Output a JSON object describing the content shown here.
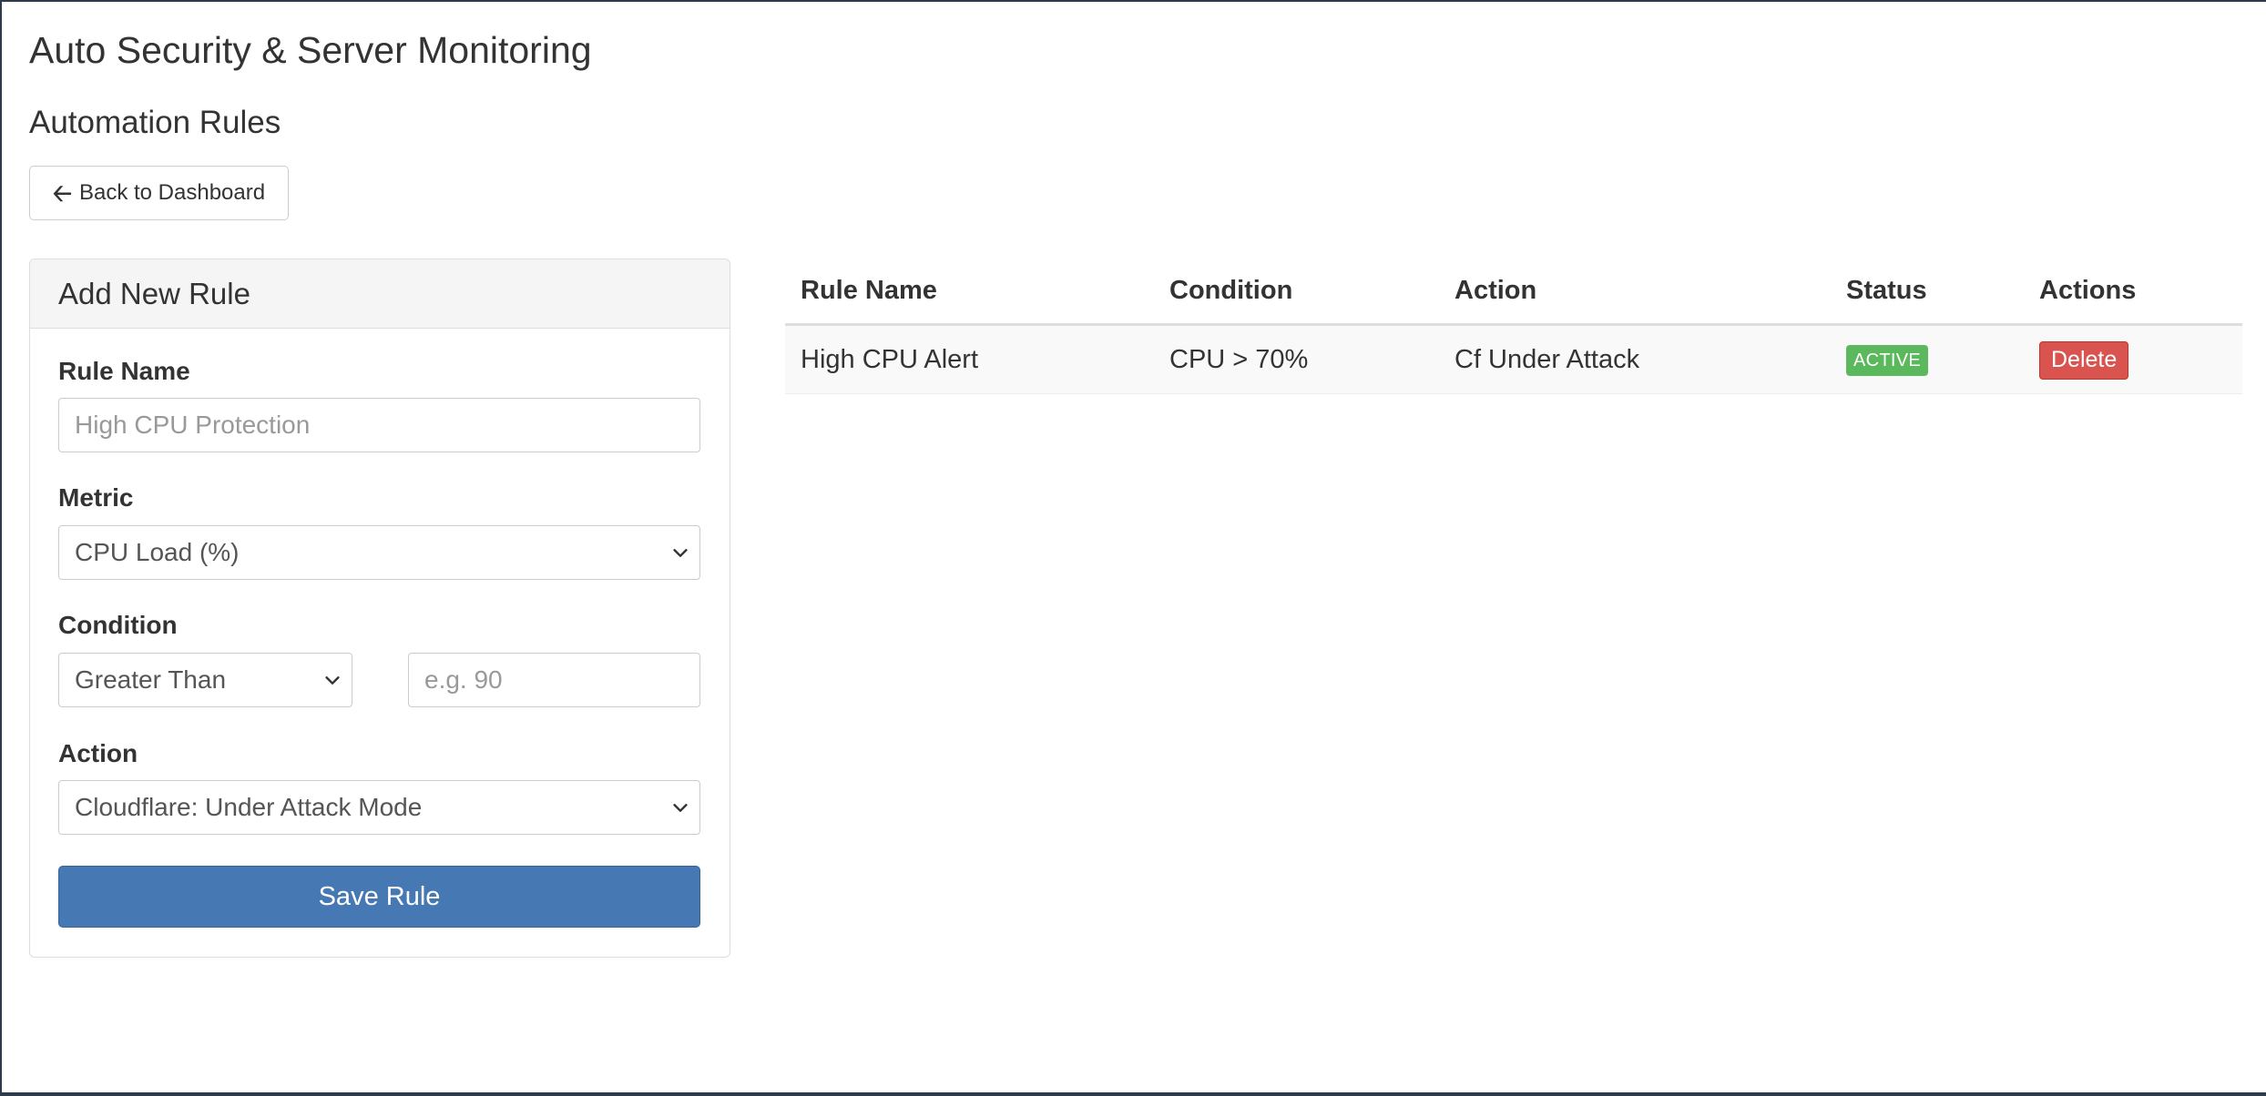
{
  "app": {
    "title": "Auto Security & Server Monitoring"
  },
  "page": {
    "section_title": "Automation Rules",
    "back_button_label": "Back to Dashboard",
    "back_icon": "arrow-left-icon"
  },
  "form": {
    "heading": "Add New Rule",
    "rule_name": {
      "label": "Rule Name",
      "value": "",
      "placeholder": "High CPU Protection"
    },
    "metric": {
      "label": "Metric",
      "selected": "CPU Load (%)"
    },
    "condition": {
      "label": "Condition",
      "operator_selected": "Greater Than",
      "threshold_value": "",
      "threshold_placeholder": "e.g. 90"
    },
    "action": {
      "label": "Action",
      "selected": "Cloudflare: Under Attack Mode"
    },
    "save_label": "Save Rule"
  },
  "table": {
    "headers": [
      "Rule Name",
      "Condition",
      "Action",
      "Status",
      "Actions"
    ],
    "rows": [
      {
        "rule_name": "High CPU Alert",
        "condition": "CPU > 70%",
        "action": "Cf Under Attack",
        "status": "ACTIVE",
        "delete_label": "Delete"
      }
    ]
  },
  "colors": {
    "primary": "#4679b4",
    "success": "#5cb85c",
    "danger": "#d9534f",
    "frame": "#2e3b4b"
  }
}
